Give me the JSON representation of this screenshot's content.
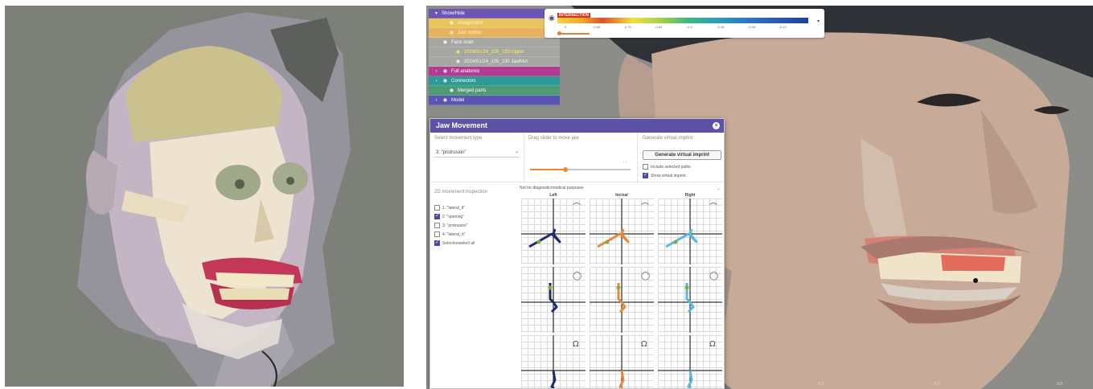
{
  "tree": {
    "header": "Show/Hide",
    "help_icon": "?",
    "items": [
      {
        "label": "Assignment",
        "cls": "r-assign",
        "icon": "eye-icon"
      },
      {
        "label": "Jaw motion",
        "cls": "r-jaw",
        "icon": "eye-icon"
      },
      {
        "label": "Face scan",
        "cls": "r-face",
        "icon": "eye-icon"
      },
      {
        "label": "2024/01/24_105_130 Upper",
        "cls": "r-sub1",
        "icon": "eye-icon"
      },
      {
        "label": "2024/01/24_105_130 JawMot",
        "cls": "r-sub2",
        "icon": "eye-icon"
      },
      {
        "label": "Full anatomic",
        "cls": "r-full",
        "icon": "eye-icon"
      },
      {
        "label": "Connectors",
        "cls": "r-conn",
        "icon": "eye-icon"
      },
      {
        "label": "Merged parts",
        "cls": "r-merged",
        "icon": "eye-icon"
      },
      {
        "label": "Model",
        "cls": "r-model",
        "icon": "eye-icon"
      }
    ]
  },
  "colorbar": {
    "label": "INTERSECTION",
    "ticks": [
      "0",
      "-0.65",
      "-0.75",
      "-0.82",
      "-0.9",
      "-0.16",
      "-0.35",
      "-0.12"
    ]
  },
  "dialog": {
    "title": "Jaw Movement",
    "select_label": "Select movement type",
    "select_value": "3: \"protrusion\"",
    "drag_label": "Drag slider to move jaw",
    "slider_value": 0.35,
    "generate_label": "Generate virtual imprint",
    "generate_button": "Generate virtual imprint",
    "include_paths": "Include selected paths",
    "show_imprint": "Show virtual imprint",
    "inspection_label": "2D movement inspection",
    "movements": [
      {
        "label": "1: \"lateral_lt\"",
        "checked": false
      },
      {
        "label": "2: \"opening\"",
        "checked": true
      },
      {
        "label": "3: \"protrusion\"",
        "checked": false
      },
      {
        "label": "4: \"lateral_rt\"",
        "checked": false
      },
      {
        "label": "Select/unselect all",
        "checked": true
      }
    ],
    "disclaimer": "Not for diagnostic/medical purposes",
    "columns": [
      "Left",
      "Incisal",
      "Right"
    ]
  },
  "bottom_ticks": [
    "-0.6",
    "-0.3",
    "0.0"
  ],
  "colors": {
    "orange": "#e68a3a",
    "navy": "#1f2a6b",
    "lightblue": "#5ab7e0",
    "purple": "#5b52a8"
  }
}
